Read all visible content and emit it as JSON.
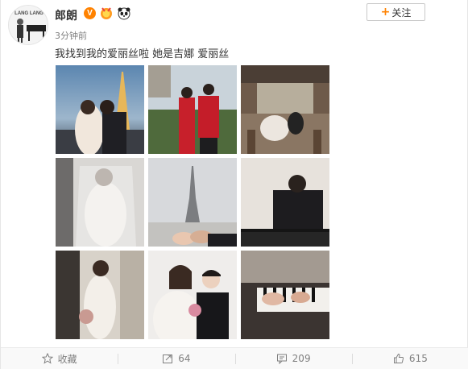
{
  "post": {
    "username": "郎朗",
    "time": "3分钟前",
    "text": "我找到我的爱丽丝啦 她是吉娜 爱丽丝",
    "avatar_text": "LANG LANG"
  },
  "header": {
    "follow_label": "关注",
    "follow_plus": "+"
  },
  "badges": {
    "verified": "V"
  },
  "footer": {
    "favorite_label": "收藏",
    "repost_count": "64",
    "comment_count": "209",
    "like_count": "615"
  },
  "colors": {
    "accent": "#ff8200",
    "text": "#333333",
    "muted": "#808080"
  },
  "icons": {
    "favorite": "star-icon",
    "repost": "share-icon",
    "comment": "comment-icon",
    "like": "thumbs-up-icon"
  },
  "photos": [
    "eiffel-tower-night-couple",
    "couple-red-qipao",
    "paris-cafe",
    "bride-veil",
    "eiffel-tower-hands",
    "pianist-playing",
    "bride-window",
    "couple-portrait",
    "piano-keys-hands"
  ]
}
